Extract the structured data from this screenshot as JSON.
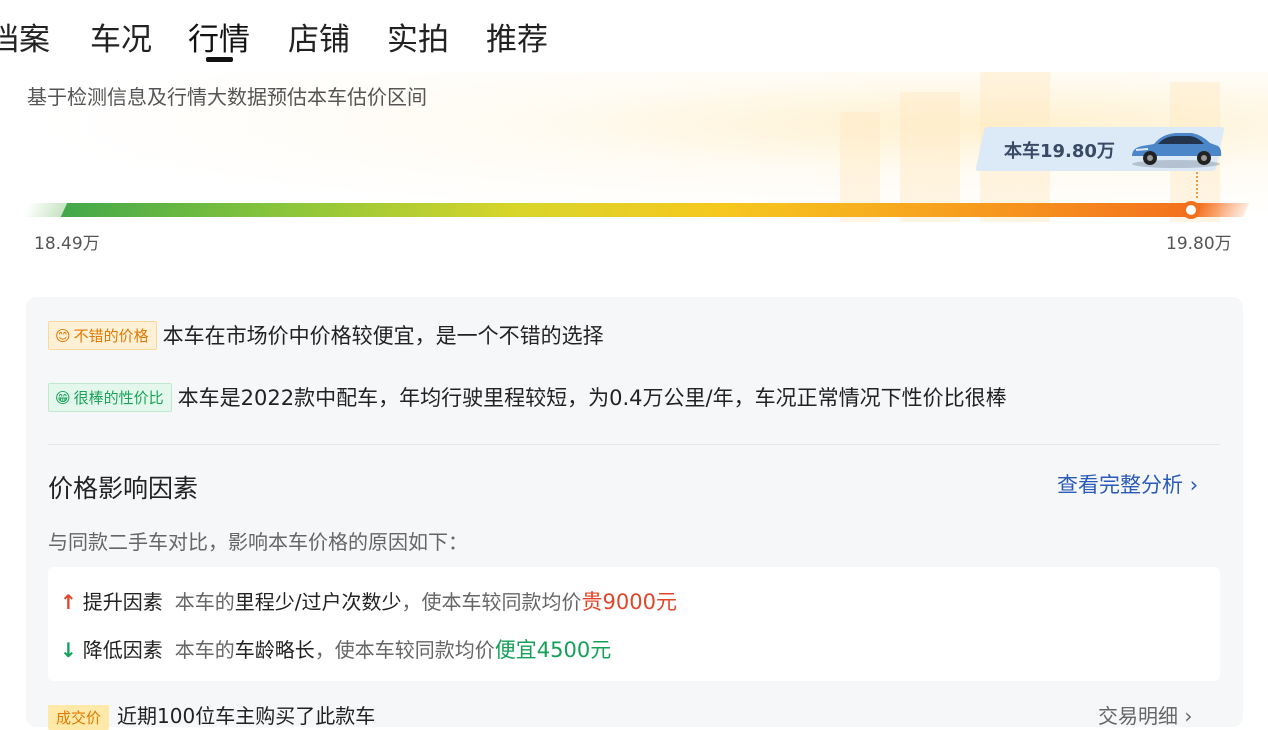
{
  "tabs": [
    {
      "label": "档案"
    },
    {
      "label": "车况"
    },
    {
      "label": "行情"
    },
    {
      "label": "店铺"
    },
    {
      "label": "实拍"
    },
    {
      "label": "推荐"
    }
  ],
  "active_tab": "行情",
  "estimate": {
    "description": "基于检测信息及行情大数据预估本车估价区间",
    "car_price_tag": "本车19.80万",
    "range_min": "18.49万",
    "range_max": "19.80万",
    "car_position_fraction": 1.0
  },
  "evaluation": {
    "items": [
      {
        "badge_icon": "smile-emoji-icon",
        "badge": "不错的价格",
        "text": "本车在市场价中价格较便宜，是一个不错的选择"
      },
      {
        "badge_icon": "grin-emoji-icon",
        "badge": "很棒的性价比",
        "text": "本车是2022款中配车，年均行驶里程较短，为0.4万公里/年，车况正常情况下性价比很棒"
      }
    ]
  },
  "factors": {
    "title": "价格影响因素",
    "link": "查看完整分析",
    "link_chevron": "›",
    "subtitle": "与同款二手车对比，影响本车价格的原因如下：",
    "up": {
      "arrow": "↑",
      "label": "提升因素",
      "prefix": "本车的",
      "keyword": "里程少/过户次数少",
      "middle": "，使本车较同款均价",
      "result": "贵9000元"
    },
    "down": {
      "arrow": "↓",
      "label": "降低因素",
      "prefix": "本车的",
      "keyword": "车龄略长",
      "middle": "，使本车较同款均价",
      "result": "便宜4500元"
    }
  },
  "deals": {
    "badge": "成交价",
    "text": "近期100位车主购买了此款车",
    "link": "交易明细 ›"
  },
  "colors": {
    "accent_orange": "#f36f1d",
    "positive_red": "#e1462a",
    "negative_green": "#15a05a",
    "link_blue": "#2a5bb8"
  }
}
